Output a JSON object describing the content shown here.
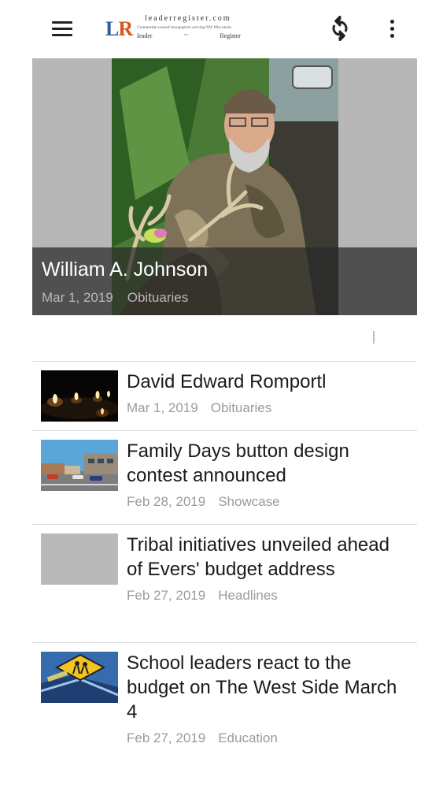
{
  "header": {
    "logo": {
      "mark_left": "L",
      "mark_right": "R",
      "site": "leaderregister.com",
      "tagline": "Community-owned newspapers serving NW Wisconsin",
      "paper_1": "leader",
      "paper_2": "Register"
    },
    "icons": [
      "menu-icon",
      "refresh-icon",
      "more-vertical-icon"
    ]
  },
  "hero": {
    "title": "William A. Johnson",
    "date": "Mar 1, 2019",
    "category": "Obituaries"
  },
  "articles": [
    {
      "title": "David Edward Romportl",
      "date": "Mar 1, 2019",
      "category": "Obituaries"
    },
    {
      "title": "Family Days button design contest announced",
      "date": "Feb 28, 2019",
      "category": "Showcase"
    },
    {
      "title": "Tribal initiatives unveiled ahead of Evers' budget address",
      "date": "Feb 27, 2019",
      "category": "Headlines"
    },
    {
      "title": "School leaders react to the budget on The West Side March 4",
      "date": "Feb 27, 2019",
      "category": "Education"
    }
  ],
  "colors": {
    "logo_blue": "#2d5f9a",
    "logo_orange": "#d9541e",
    "meta_gray": "#9b9b9b"
  }
}
